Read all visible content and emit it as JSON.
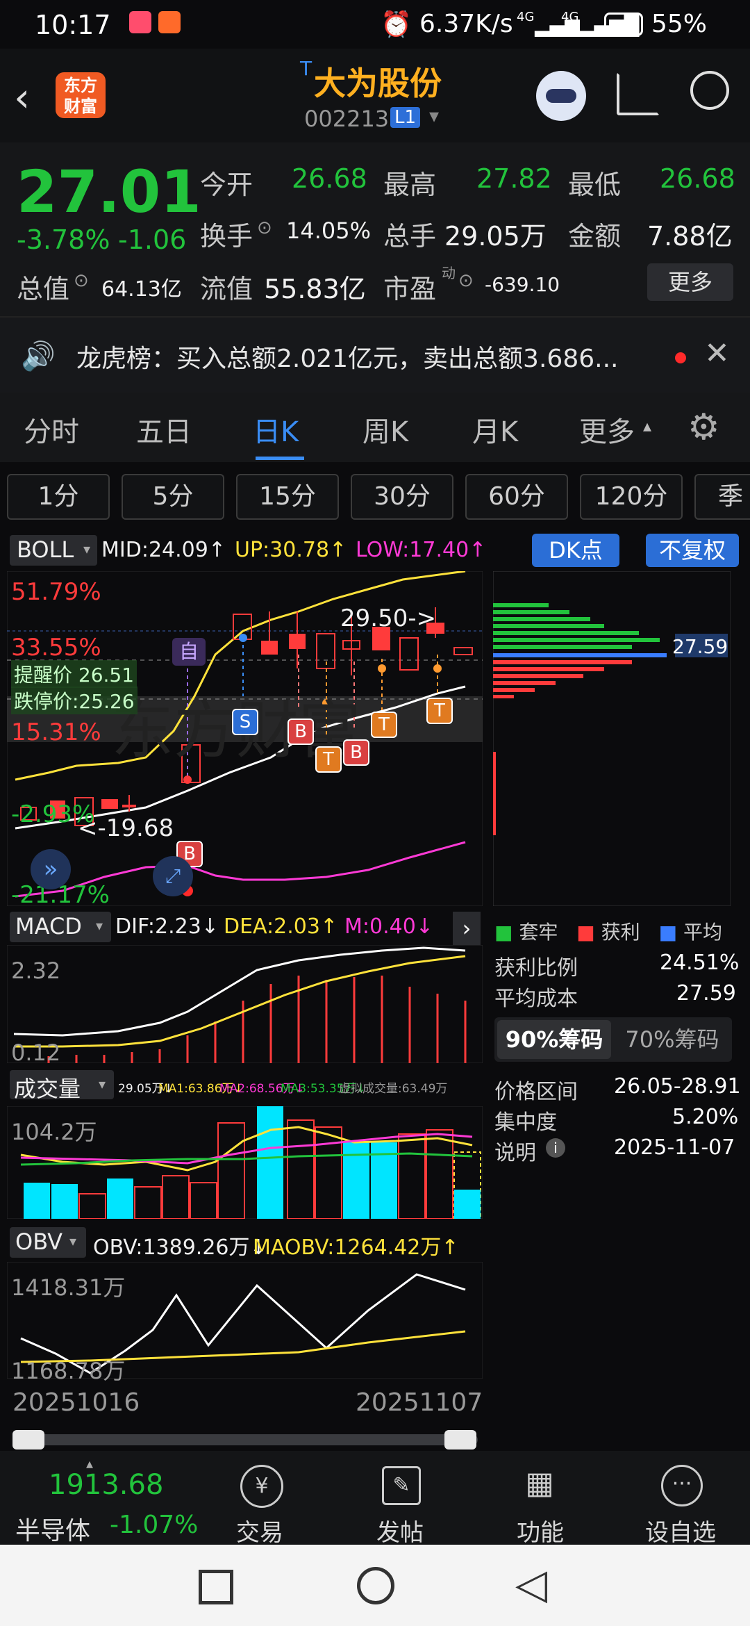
{
  "status_bar": {
    "time": "10:17",
    "speed": "6.37K/s",
    "battery": "55%",
    "signal1": "4G",
    "signal2": "4G"
  },
  "header": {
    "logo_text_1": "东方",
    "logo_text_2": "财富",
    "tag": "T",
    "title": "大为股份",
    "code": "002213",
    "level": "L1"
  },
  "quote": {
    "price": "27.01",
    "change_pct": "-3.78%",
    "change": "-1.06",
    "open_label": "今开",
    "open": "26.68",
    "high_label": "最高",
    "high": "27.82",
    "low_label": "最低",
    "low": "26.68",
    "turnover_label": "换手",
    "turnover": "14.05%",
    "volume_label": "总手",
    "volume": "29.05万",
    "amount_label": "金额",
    "amount": "7.88亿",
    "mktcap_label": "总值",
    "mktcap": "64.13亿",
    "float_label": "流值",
    "float": "55.83亿",
    "pe_label": "市盈",
    "pe_sup": "动",
    "pe": "-639.10",
    "more_label": "更多"
  },
  "ticker": {
    "text": "龙虎榜：买入总额2.021亿元，卖出总额3.686..."
  },
  "tabs": [
    "分时",
    "五日",
    "日K",
    "周K",
    "月K",
    "更多"
  ],
  "periods": [
    "1分",
    "5分",
    "15分",
    "30分",
    "60分",
    "120分",
    "季"
  ],
  "boll": {
    "name": "BOLL",
    "mid": "MID:24.09↑",
    "up": "UP:30.78↑",
    "low": "LOW:17.40↑",
    "dk_label": "DK点",
    "fq_label": "不复权",
    "pct1": "51.79%",
    "pct2": "33.55%",
    "pct3": "15.31%",
    "pct4": "-2.93%",
    "pct5": "-21.17%",
    "alert": "提醒价 26.51",
    "stop": "跌停价:25.26",
    "high_mark": "29.50->",
    "low_mark": "<-19.68",
    "self_mark": "自",
    "signals": [
      "S",
      "B",
      "T",
      "B",
      "T",
      "T",
      "B"
    ]
  },
  "macd": {
    "name": "MACD",
    "dif": "DIF:2.23↓",
    "dea": "DEA:2.03↑",
    "m": "M:0.40↓",
    "top": "2.32",
    "bottom": "0.12"
  },
  "volume": {
    "name": "成交量",
    "vol": "29.05万↓",
    "ma1": "MA1:63.86万↓",
    "ma2": "MA2:68.56万↓",
    "ma3": "MA3:53.35万↓",
    "virtual": "虚拟成交量:63.49万",
    "top": "104.2万"
  },
  "obv": {
    "name": "OBV",
    "obv": "OBV:1389.26万↓",
    "maobv": "MAOBV:1264.42万↑",
    "top": "1418.31万",
    "bottom": "1168.78万",
    "date_start": "20251016",
    "date_end": "20251107"
  },
  "chip": {
    "price": "27.59",
    "legend": [
      "套牢",
      "获利",
      "平均"
    ],
    "profit_ratio_label": "获利比例",
    "profit_ratio": "24.51%",
    "avg_cost_label": "平均成本",
    "avg_cost": "27.59",
    "tab90": "90%筹码",
    "tab70": "70%筹码",
    "range_label": "价格区间",
    "range": "26.05-28.91",
    "concentration_label": "集中度",
    "concentration": "5.20%",
    "desc_label": "说明",
    "desc_date": "2025-11-07"
  },
  "bottom_nav": {
    "index_value": "1913.68",
    "index_name": "半导体",
    "index_change": "-1.07%",
    "trade": "交易",
    "post": "发帖",
    "func": "功能",
    "watch": "设自选"
  },
  "chart_data": {
    "type": "candlestick",
    "x_range": [
      "20251016",
      "20251107"
    ],
    "price_marks": {
      "high": 29.5,
      "low": 19.68,
      "current": 27.01,
      "alert": 26.51,
      "limit_down": 25.26
    }
  }
}
